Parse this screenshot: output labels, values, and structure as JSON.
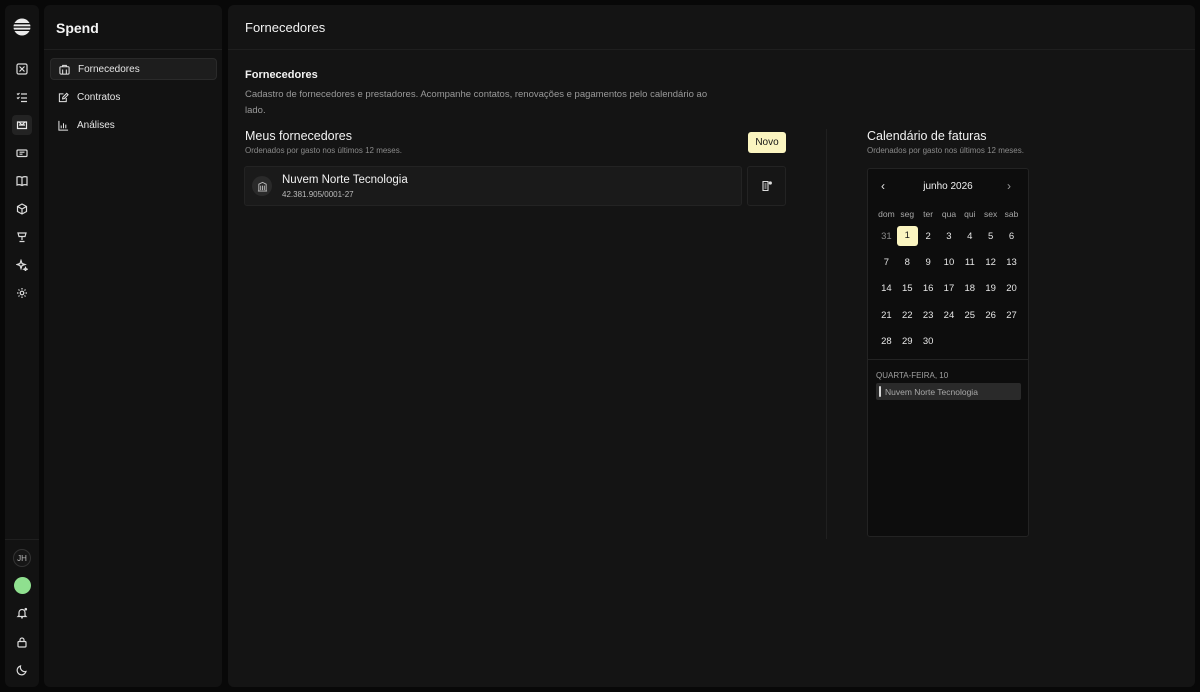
{
  "app": {
    "brand": "Spend"
  },
  "rail": {
    "avatar_initials": "JH"
  },
  "sidebar": {
    "items": [
      {
        "label": "Fornecedores"
      },
      {
        "label": "Contratos"
      },
      {
        "label": "Análises"
      }
    ]
  },
  "header": {
    "title": "Fornecedores"
  },
  "section": {
    "title": "Fornecedores",
    "description": "Cadastro de fornecedores e prestadores. Acompanhe contatos, renovações e pagamentos pelo calendário ao lado."
  },
  "vendors": {
    "title": "Meus fornecedores",
    "subtitle": "Ordenados por gasto nos últimos 12 meses.",
    "new_label": "Novo",
    "items": [
      {
        "name": "Nuvem Norte Tecnologia",
        "doc": "42.381.905/0001-27"
      }
    ]
  },
  "calendar": {
    "title": "Calendário de faturas",
    "subtitle": "Ordenados por gasto nos últimos 12 meses.",
    "month": "junho 2026",
    "prev_glyph": "‹",
    "next_glyph": "›",
    "weekdays": [
      "dom",
      "seg",
      "ter",
      "qua",
      "qui",
      "sex",
      "sab"
    ],
    "weeks": [
      [
        "31",
        "1",
        "2",
        "3",
        "4",
        "5",
        "6"
      ],
      [
        "7",
        "8",
        "9",
        "10",
        "11",
        "12",
        "13"
      ],
      [
        "14",
        "15",
        "16",
        "17",
        "18",
        "19",
        "20"
      ],
      [
        "21",
        "22",
        "23",
        "24",
        "25",
        "26",
        "27"
      ],
      [
        "28",
        "29",
        "30",
        "",
        "",
        "",
        ""
      ]
    ],
    "selected_day_label": "QUARTA-FEIRA, 10",
    "events": [
      {
        "label": "Nuvem Norte Tecnologia"
      }
    ]
  },
  "colors": {
    "accent": "#fbf5c0",
    "status": "#8fe08f",
    "background": "#141414"
  }
}
